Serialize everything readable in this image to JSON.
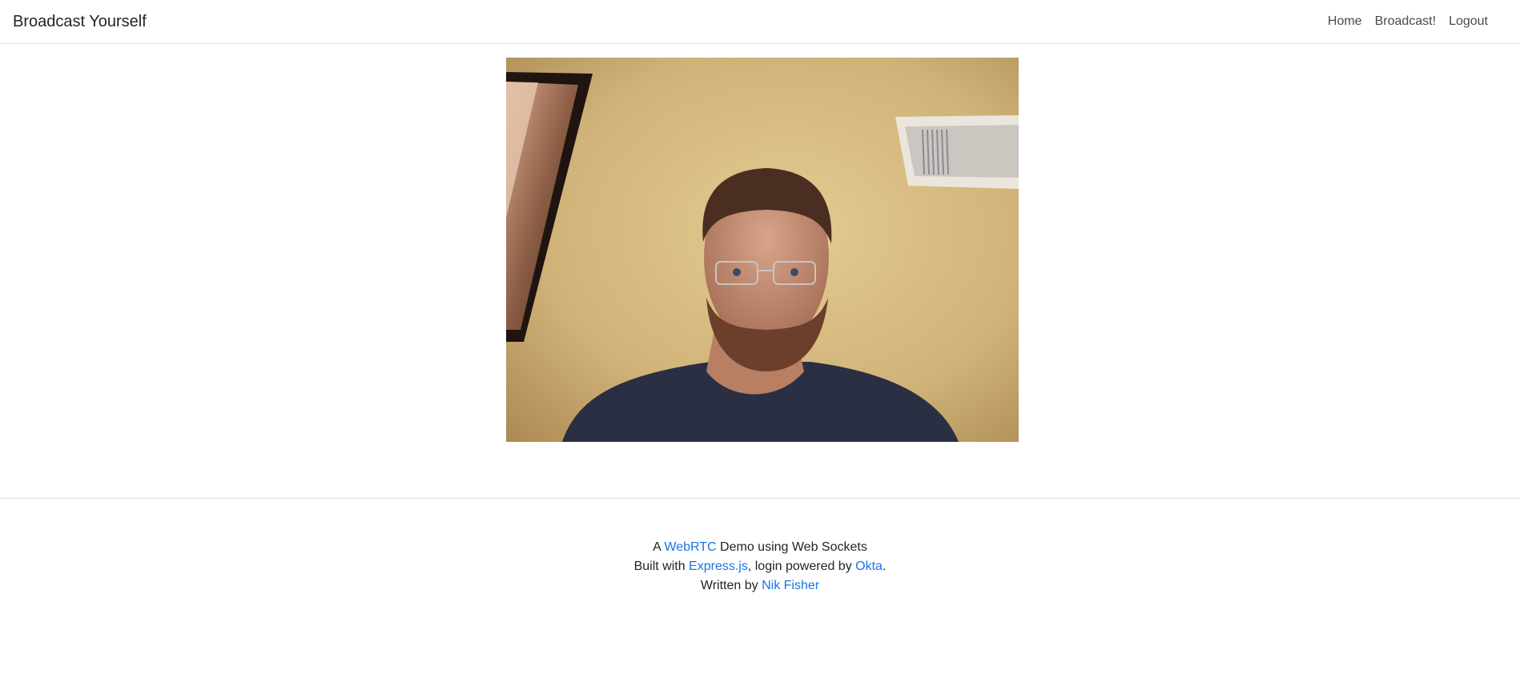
{
  "navbar": {
    "brand": "Broadcast Yourself",
    "links": [
      {
        "label": "Home"
      },
      {
        "label": "Broadcast!"
      },
      {
        "label": "Logout"
      }
    ]
  },
  "footer": {
    "line1": {
      "prefix": "A ",
      "link": "WebRTC",
      "suffix": " Demo using Web Sockets"
    },
    "line2": {
      "prefix": "Built with ",
      "link1": "Express.js",
      "middle": ", login powered by ",
      "link2": "Okta",
      "suffix": "."
    },
    "line3": {
      "prefix": "Written by ",
      "link": "Nik Fisher"
    }
  },
  "colors": {
    "link": "#1a73e8",
    "wall": "#c9ab6e",
    "shirt": "#2b2f44"
  }
}
